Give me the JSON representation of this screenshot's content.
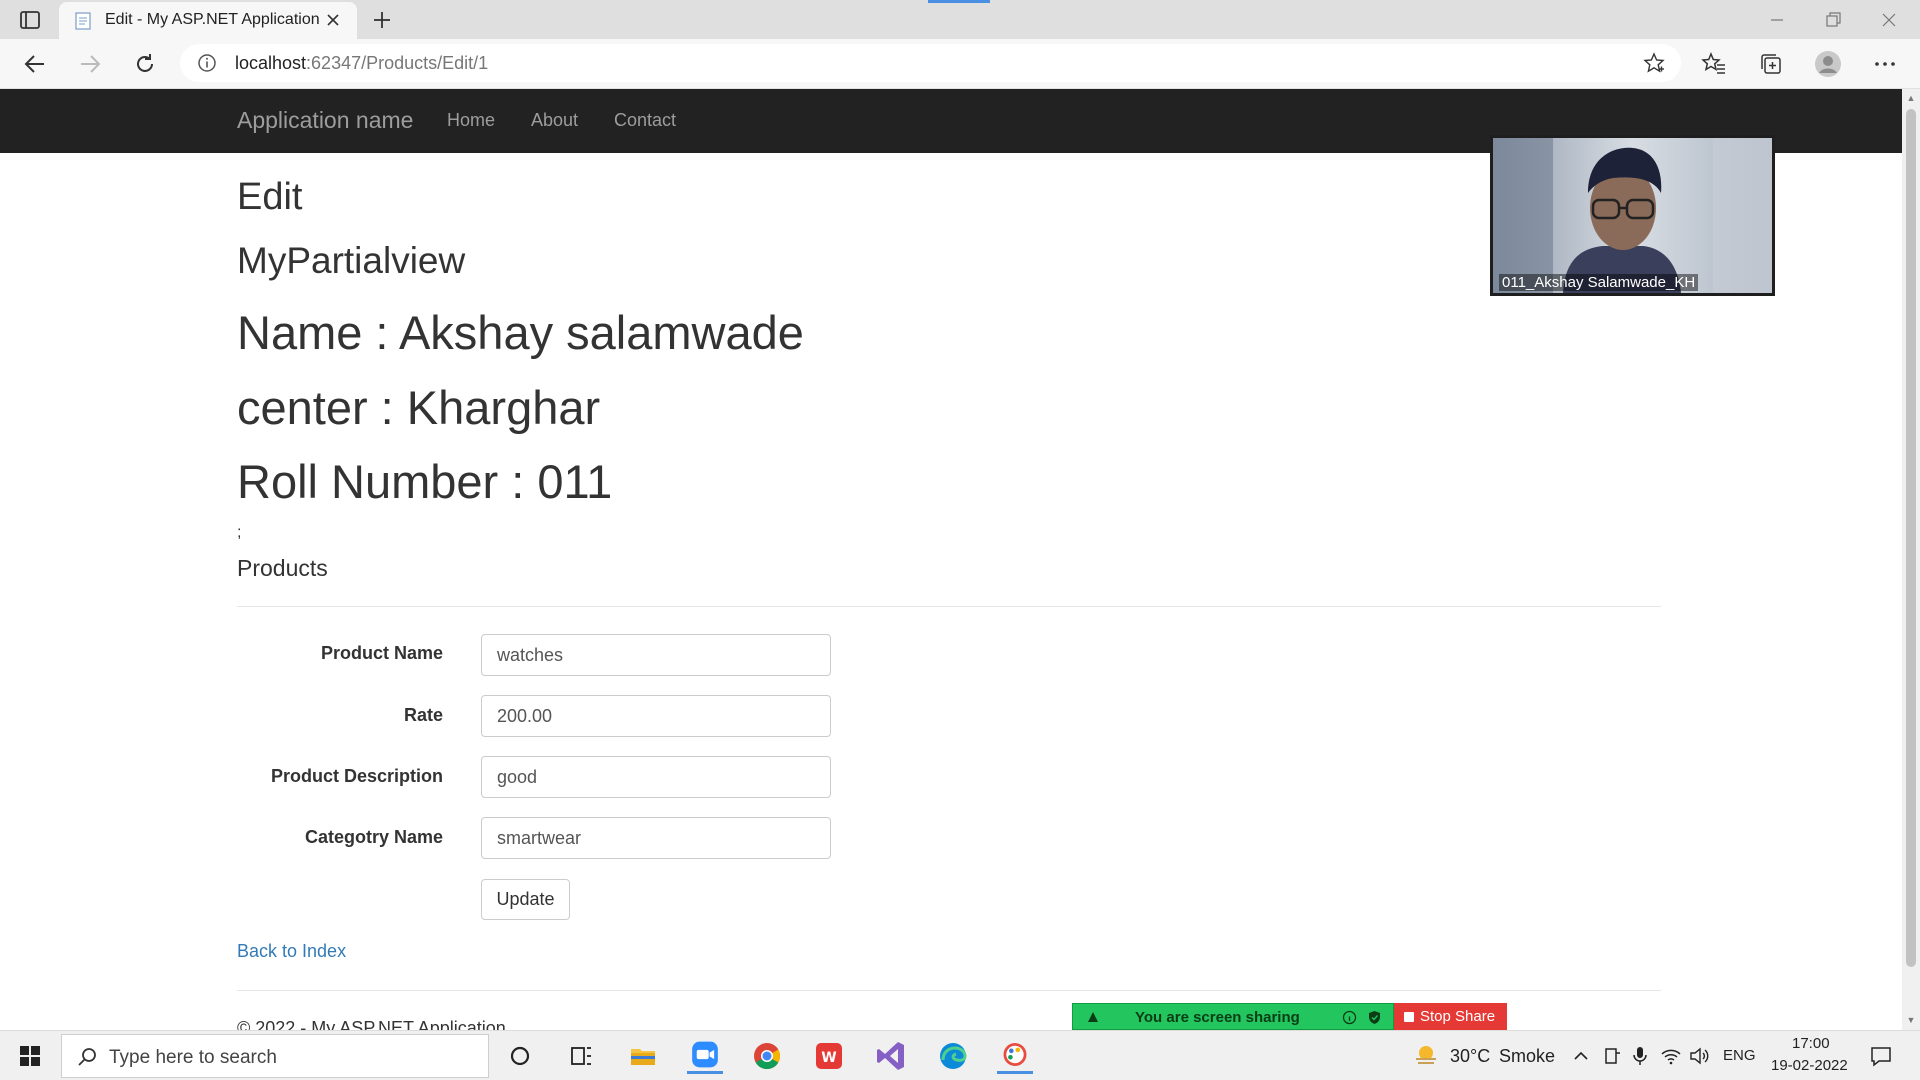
{
  "browser": {
    "tab_title": "Edit - My ASP.NET Application",
    "url_host": "localhost",
    "url_path": ":62347/Products/Edit/1"
  },
  "navbar": {
    "brand": "Application name",
    "links": [
      "Home",
      "About",
      "Contact"
    ]
  },
  "page": {
    "heading": "Edit",
    "partial_heading": "MyPartialview",
    "name_line": "Name : Akshay salamwade",
    "center_line": "center : Kharghar",
    "roll_line": "Roll Number : 011",
    "stray_text": ";",
    "section_heading": "Products"
  },
  "form": {
    "fields": [
      {
        "label": "Product Name",
        "value": "watches"
      },
      {
        "label": "Rate",
        "value": "200.00"
      },
      {
        "label": "Product Description",
        "value": "good"
      },
      {
        "label": "Categotry Name",
        "value": "smartwear"
      }
    ],
    "submit_label": "Update"
  },
  "back_link": "Back to Index",
  "footer": "© 2022 - My ASP.NET Application",
  "video": {
    "participant_label": "011_Akshay Salamwade_KH"
  },
  "screen_share": {
    "status_text": "You are screen sharing",
    "stop_label": "Stop Share"
  },
  "taskbar": {
    "search_placeholder": "Type here to search",
    "weather_temp": "30°C",
    "weather_text": "Smoke",
    "language": "ENG",
    "time": "17:00",
    "date": "19-02-2022"
  },
  "colors": {
    "navbar_bg": "#222222",
    "link": "#337ab7",
    "share_green": "#22c55e",
    "stop_red": "#e53935"
  }
}
